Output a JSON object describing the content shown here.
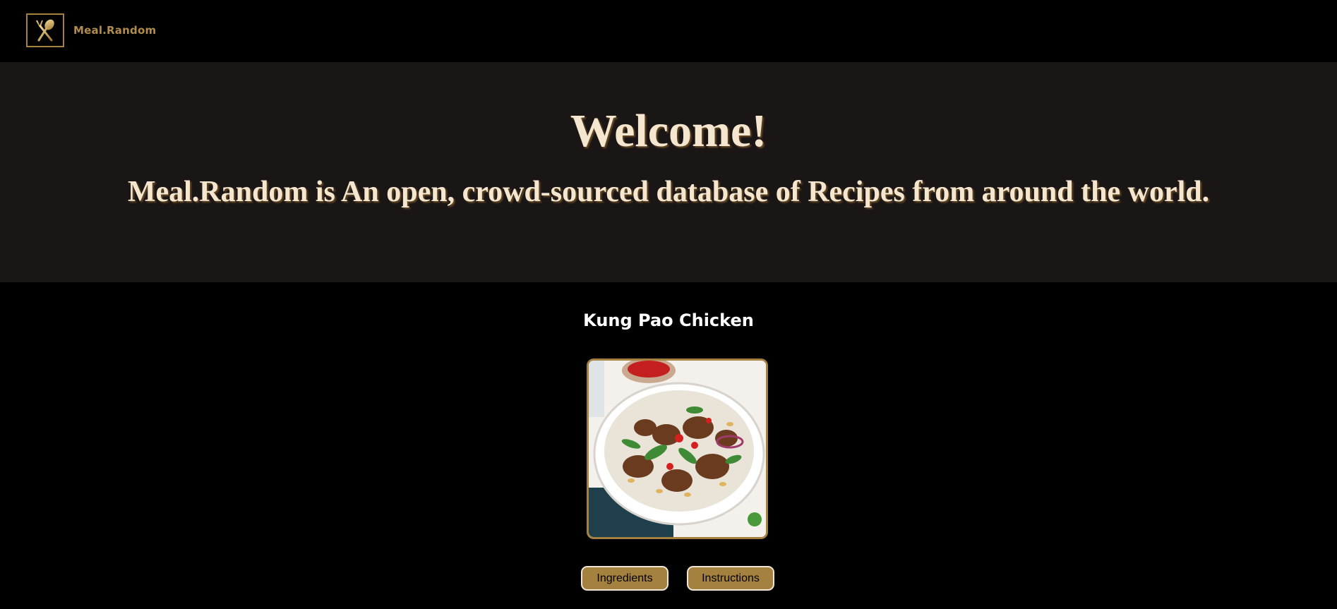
{
  "app": {
    "logo_text": "Meal.Random",
    "logo_icon": "fork-spoon-icon"
  },
  "hero": {
    "title": "Welcome!",
    "subtitle": "Meal.Random is An open, crowd-sourced database of Recipes from around the world."
  },
  "meal": {
    "name": "Kung Pao Chicken",
    "image_alt": "Kung Pao Chicken"
  },
  "buttons": {
    "ingredients": "Ingredients",
    "instructions": "Instructions"
  },
  "colors": {
    "accent": "#a5813f",
    "hero_bg": "#1a1616",
    "page_bg": "#000000",
    "hero_text": "#f5e7cf"
  }
}
